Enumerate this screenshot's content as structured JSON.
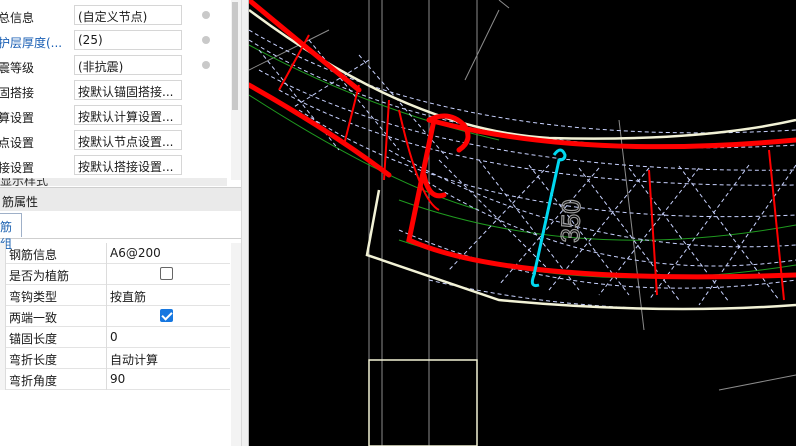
{
  "top_properties": [
    {
      "label": "总信息",
      "value": "(自定义节点)",
      "label_color": "#1a1a1a"
    },
    {
      "label": "护层厚度(...",
      "value": "(25)",
      "label_color": "#1a5fb4"
    },
    {
      "label": "震等级",
      "value": "(非抗震)",
      "label_color": "#1a1a1a"
    },
    {
      "label": "固搭接",
      "value": "按默认锚固搭接...",
      "label_color": "#1a1a1a"
    },
    {
      "label": "算设置",
      "value": "按默认计算设置...",
      "label_color": "#1a1a1a"
    },
    {
      "label": "点设置",
      "value": "按默认节点设置...",
      "label_color": "#1a1a1a"
    },
    {
      "label": "接设置",
      "value": "按默认搭接设置...",
      "label_color": "#1a1a1a"
    }
  ],
  "partial_row_text": "显示样式",
  "rebar_panel": {
    "title": "筋属性",
    "tab_label": "筋组"
  },
  "rebar_properties": [
    {
      "key": "钢筋信息",
      "value": "A6@200",
      "type": "text"
    },
    {
      "key": "是否为植筋",
      "value": "",
      "type": "checkbox",
      "checked": false
    },
    {
      "key": "弯钩类型",
      "value": "按直筋",
      "type": "text"
    },
    {
      "key": "两端一致",
      "value": "",
      "type": "checkbox",
      "checked": true
    },
    {
      "key": "锚固长度",
      "value": "0",
      "type": "text"
    },
    {
      "key": "弯折长度",
      "value": "自动计算",
      "type": "text"
    },
    {
      "key": "弯折角度",
      "value": "90",
      "type": "text"
    }
  ],
  "drawing": {
    "dimension_text": "350",
    "colors": {
      "outline": "#f2f2d6",
      "rebar_main": "#ff0000",
      "selected_rebar": "#00d8f0",
      "stirrup_dash": "#c8d2ff",
      "green_line": "#1f9a1f",
      "grey_line": "#8c8c8c"
    }
  }
}
